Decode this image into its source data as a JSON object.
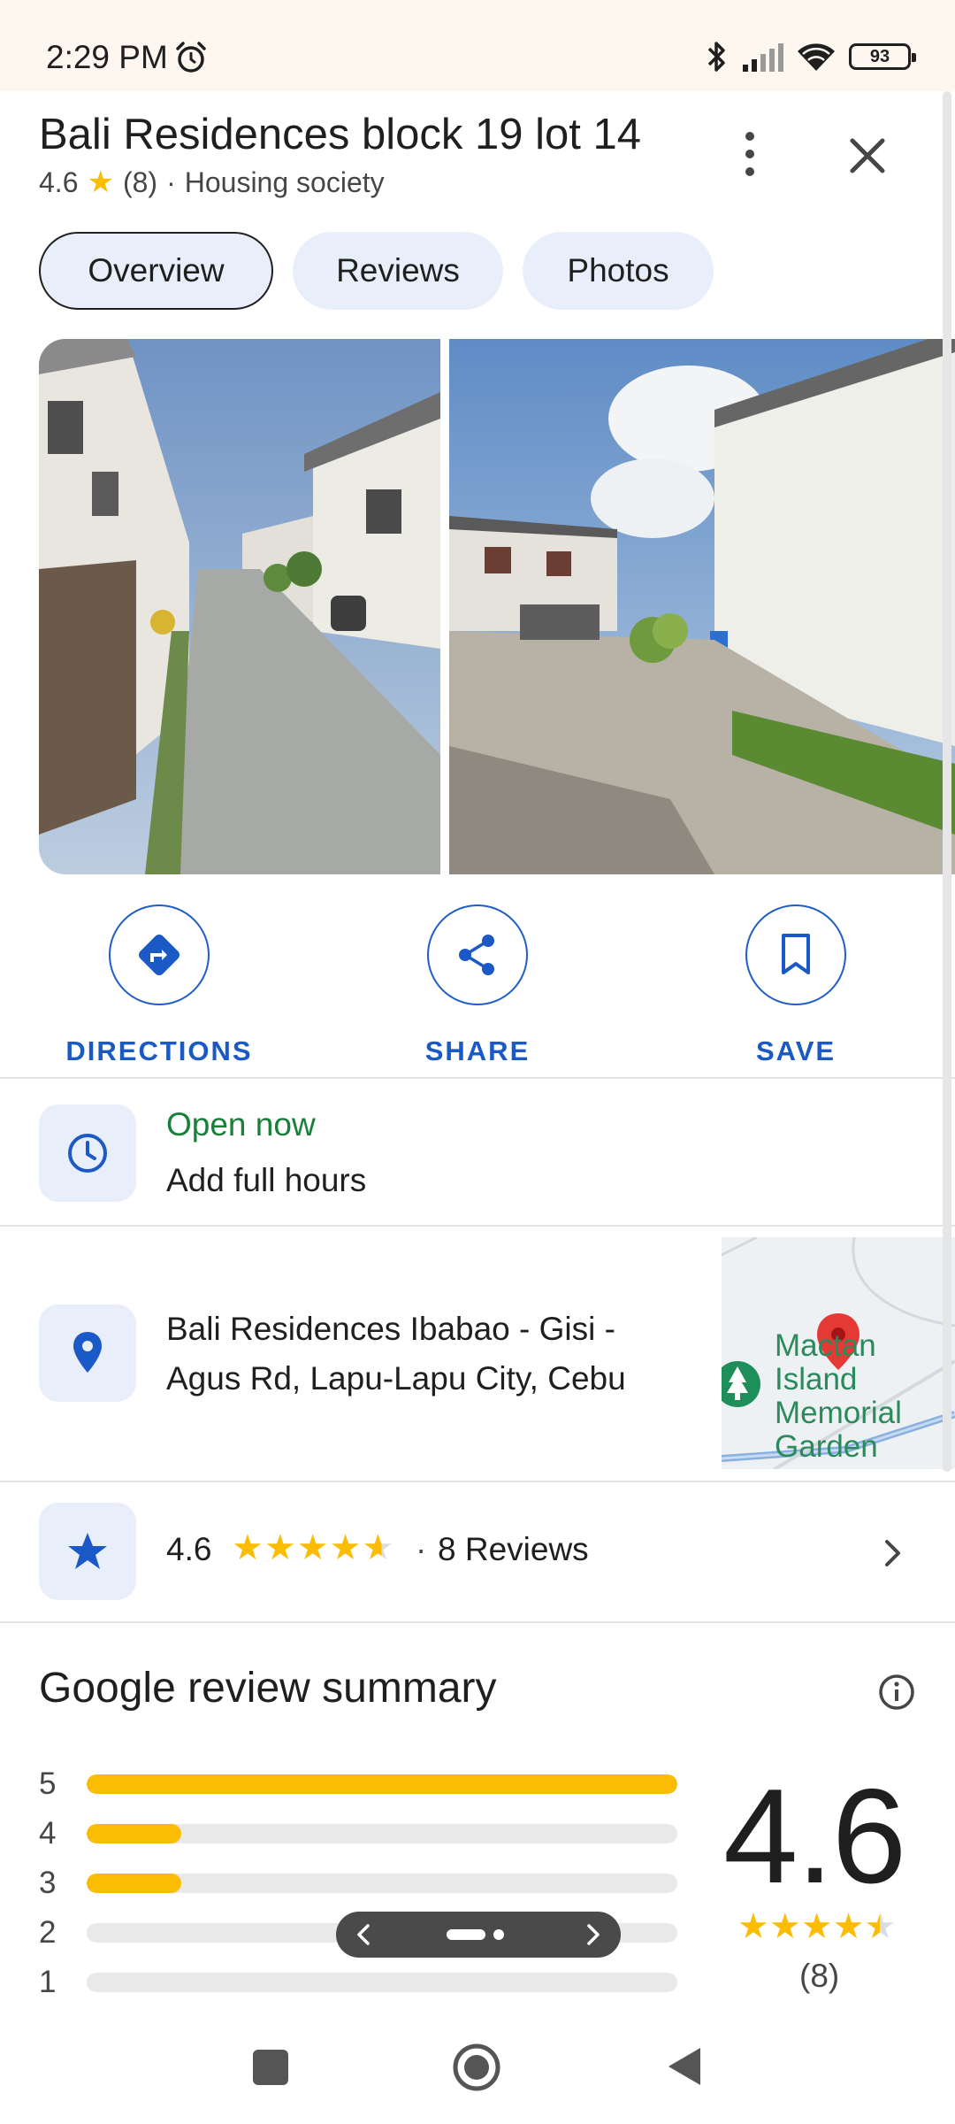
{
  "status_bar": {
    "time": "2:29 PM",
    "battery": "93",
    "icons": [
      "alarm-icon",
      "bluetooth-icon",
      "signal-icon",
      "wifi-icon",
      "battery-icon"
    ]
  },
  "header": {
    "title": "Bali Residences block 19 lot 14",
    "rating": "4.6",
    "review_count": "(8)",
    "separator": "·",
    "category": "Housing society"
  },
  "tabs": [
    {
      "label": "Overview",
      "active": true
    },
    {
      "label": "Reviews",
      "active": false
    },
    {
      "label": "Photos",
      "active": false
    }
  ],
  "actions": {
    "directions": "DIRECTIONS",
    "share": "SHARE",
    "save": "SAVE"
  },
  "hours": {
    "status": "Open now",
    "action": "Add full hours"
  },
  "address": {
    "text": "Bali Residences Ibabao - Gisi - Agus Rd, Lapu-Lapu City, Cebu",
    "map_label": "Mactan Island Memorial Garden"
  },
  "rating_row": {
    "value": "4.6",
    "stars": "★★★★★",
    "separator": "·",
    "reviews": "8 Reviews"
  },
  "summary": {
    "title": "Google review summary",
    "bars": [
      {
        "label": "5",
        "fraction": 1.0
      },
      {
        "label": "4",
        "fraction": 0.16
      },
      {
        "label": "3",
        "fraction": 0.16
      },
      {
        "label": "2",
        "fraction": 0.0
      },
      {
        "label": "1",
        "fraction": 0.0
      }
    ],
    "rating": "4.6",
    "stars": "★★★★★",
    "count": "(8)"
  },
  "colors": {
    "accent_blue": "#1a59c6",
    "star_yellow": "#fbbc04",
    "open_green": "#188038",
    "tab_bg": "#e8effa"
  }
}
